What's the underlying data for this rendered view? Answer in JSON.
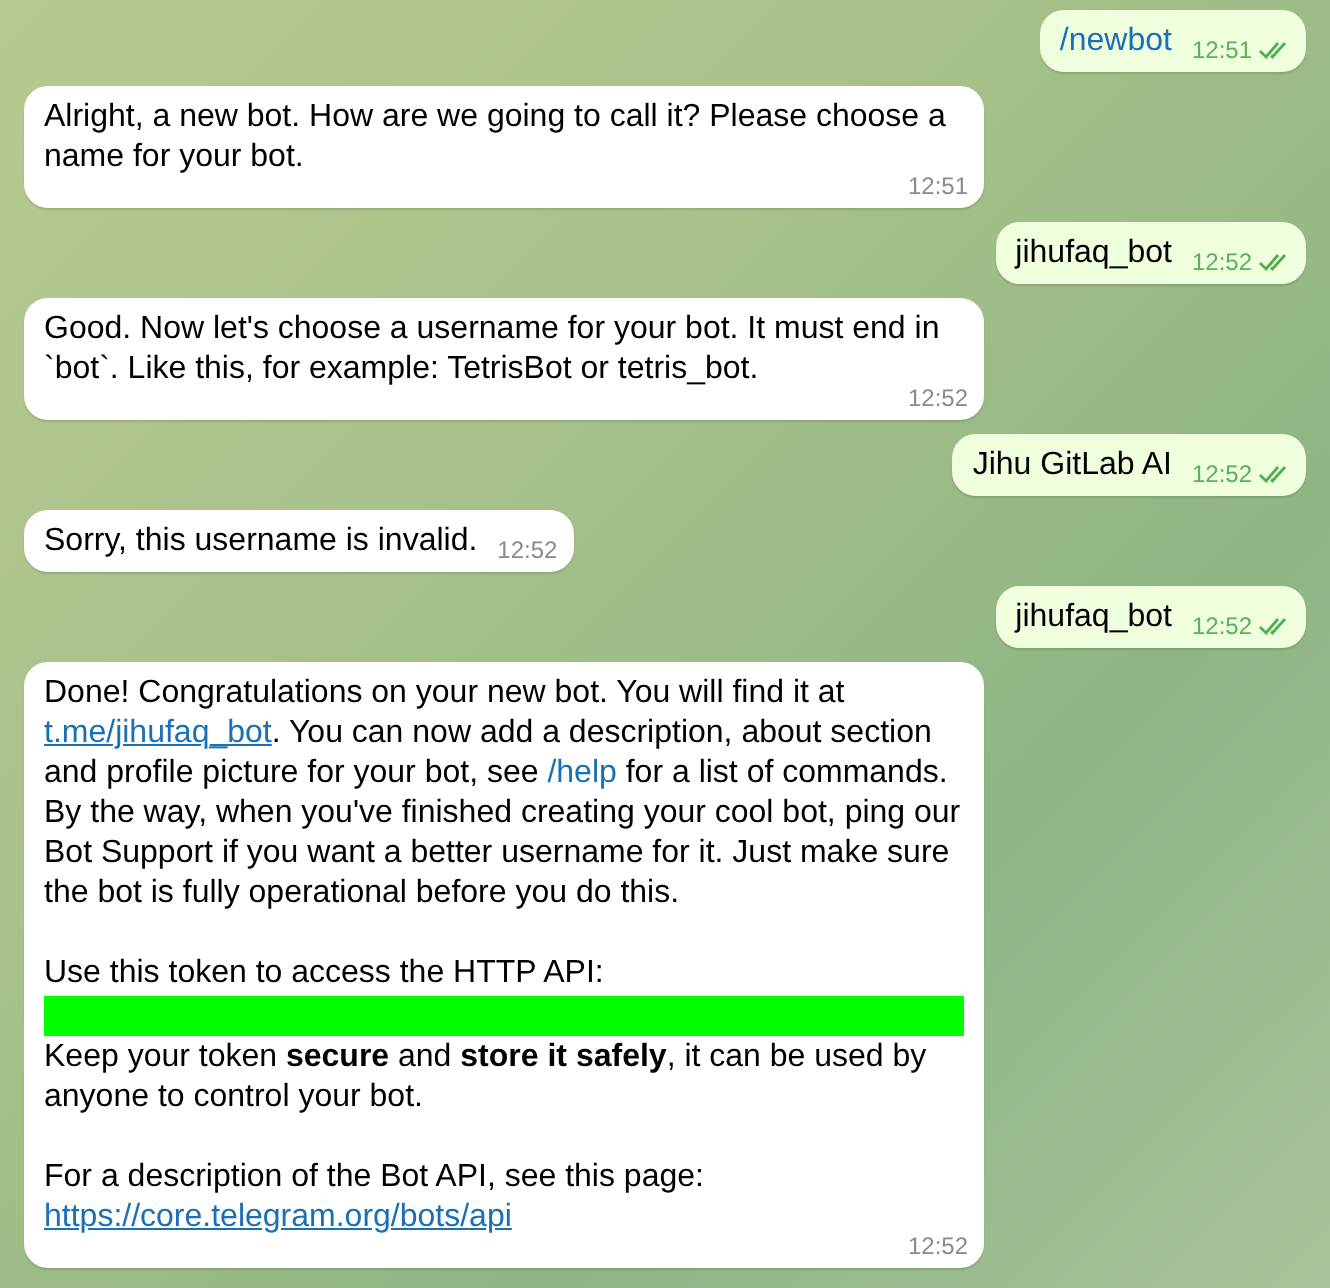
{
  "messages": [
    {
      "outgoing": true,
      "read": true,
      "time": "12:51",
      "sections": [
        [
          {
            "kind": "paragraph",
            "segments": [
              {
                "kind": "command",
                "text": "/newbot"
              }
            ]
          }
        ]
      ]
    },
    {
      "outgoing": false,
      "time": "12:51",
      "sections": [
        [
          {
            "kind": "paragraph",
            "segments": [
              {
                "kind": "text",
                "text": "Alright, a new bot. How are we going to call it? Please choose a name for your bot."
              }
            ]
          }
        ]
      ]
    },
    {
      "outgoing": true,
      "read": true,
      "time": "12:52",
      "sections": [
        [
          {
            "kind": "paragraph",
            "segments": [
              {
                "kind": "text",
                "text": "jihufaq_bot"
              }
            ]
          }
        ]
      ]
    },
    {
      "outgoing": false,
      "time": "12:52",
      "sections": [
        [
          {
            "kind": "paragraph",
            "segments": [
              {
                "kind": "text",
                "text": "Good. Now let's choose a username for your bot. It must end in `bot`. Like this, for example: TetrisBot or tetris_bot."
              }
            ]
          }
        ]
      ]
    },
    {
      "outgoing": true,
      "read": true,
      "time": "12:52",
      "sections": [
        [
          {
            "kind": "paragraph",
            "segments": [
              {
                "kind": "text",
                "text": "Jihu GitLab AI"
              }
            ]
          }
        ]
      ]
    },
    {
      "outgoing": false,
      "time": "12:52",
      "sections": [
        [
          {
            "kind": "paragraph",
            "segments": [
              {
                "kind": "text",
                "text": "Sorry, this username is invalid."
              }
            ]
          }
        ]
      ]
    },
    {
      "outgoing": true,
      "read": true,
      "time": "12:52",
      "sections": [
        [
          {
            "kind": "paragraph",
            "segments": [
              {
                "kind": "text",
                "text": "jihufaq_bot"
              }
            ]
          }
        ]
      ]
    },
    {
      "outgoing": false,
      "time": "12:52",
      "sections": [
        [
          {
            "kind": "paragraph",
            "segments": [
              {
                "kind": "text",
                "text": "Done! Congratulations on your new bot. You will find it at "
              },
              {
                "kind": "link",
                "text": "t.me/jihufaq_bot"
              },
              {
                "kind": "text",
                "text": ". You can now add a description, about section and profile picture for your bot, see "
              },
              {
                "kind": "command",
                "text": "/help"
              },
              {
                "kind": "text",
                "text": " for a list of commands. By the way, when you've finished creating your cool bot, ping our Bot Support if you want a better username for it. Just make sure the bot is fully operational before you do this."
              }
            ]
          }
        ],
        [
          {
            "kind": "paragraph",
            "segments": [
              {
                "kind": "text",
                "text": "Use this token to access the HTTP API:"
              }
            ]
          },
          {
            "kind": "redaction",
            "color": "#00ff00"
          },
          {
            "kind": "paragraph",
            "segments": [
              {
                "kind": "text",
                "text": "Keep your token **secure** and **store it safely**, it can be used by anyone to control your bot."
              }
            ]
          }
        ],
        [
          {
            "kind": "paragraph",
            "segments": [
              {
                "kind": "text",
                "text": "For a description of the Bot API, see this page:"
              }
            ]
          },
          {
            "kind": "paragraph",
            "segments": [
              {
                "kind": "link",
                "text": "https://core.telegram.org/bots/api"
              }
            ]
          }
        ]
      ]
    }
  ]
}
